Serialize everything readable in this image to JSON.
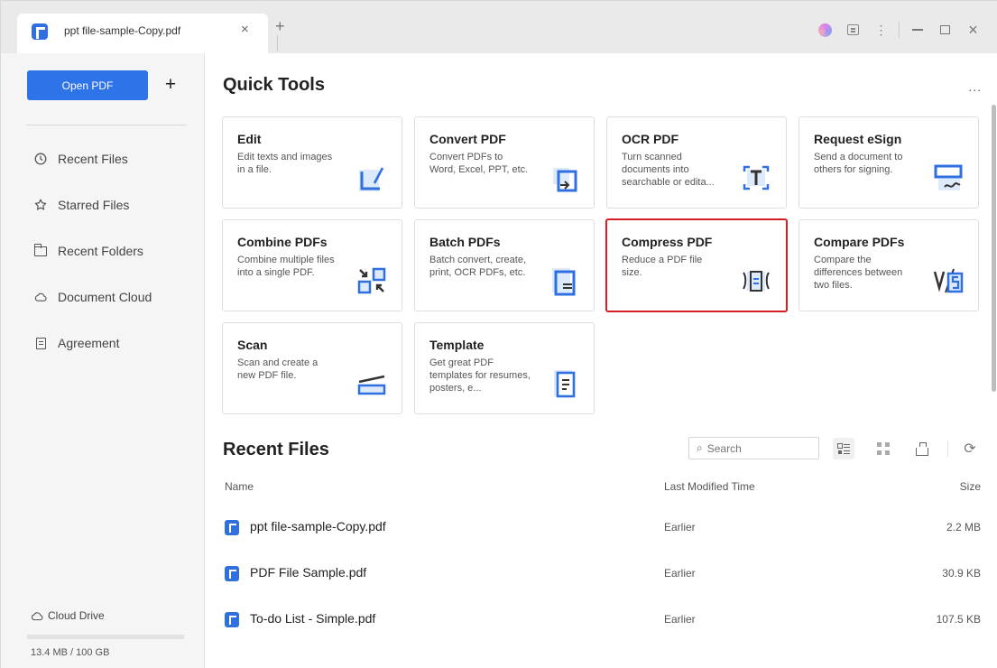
{
  "tab": {
    "title": "ppt file-sample-Copy.pdf",
    "close": "×",
    "new": "+"
  },
  "window_controls": {
    "close": "×"
  },
  "sidebar": {
    "open_label": "Open PDF",
    "plus_label": "+",
    "items": [
      {
        "label": "Recent Files",
        "icon": "clock-icon"
      },
      {
        "label": "Starred Files",
        "icon": "star-icon"
      },
      {
        "label": "Recent Folders",
        "icon": "folder-icon"
      },
      {
        "label": "Document Cloud",
        "icon": "cloud-icon"
      },
      {
        "label": "Agreement",
        "icon": "agreement-icon"
      }
    ],
    "cloud_drive_label": "Cloud Drive",
    "storage": {
      "text": "13.4 MB / 100 GB",
      "used_fraction": 0.000134
    }
  },
  "quick_tools": {
    "title": "Quick Tools",
    "more": "...",
    "cards": [
      {
        "title": "Edit",
        "desc": "Edit texts and images in a file.",
        "icon": "edit-icon"
      },
      {
        "title": "Convert PDF",
        "desc": "Convert PDFs to Word, Excel, PPT, etc.",
        "icon": "convert-icon"
      },
      {
        "title": "OCR PDF",
        "desc": "Turn scanned documents into searchable or edita...",
        "icon": "ocr-icon"
      },
      {
        "title": "Request eSign",
        "desc": "Send a document to others for signing.",
        "icon": "esign-icon"
      },
      {
        "title": "Combine PDFs",
        "desc": "Combine multiple files into a single PDF.",
        "icon": "combine-icon"
      },
      {
        "title": "Batch PDFs",
        "desc": "Batch convert, create, print, OCR PDFs, etc.",
        "icon": "batch-icon"
      },
      {
        "title": "Compress PDF",
        "desc": "Reduce a PDF file size.",
        "icon": "compress-icon"
      },
      {
        "title": "Compare PDFs",
        "desc": "Compare the differences between two files.",
        "icon": "compare-icon"
      },
      {
        "title": "Scan",
        "desc": "Scan and create a new PDF file.",
        "icon": "scan-icon"
      },
      {
        "title": "Template",
        "desc": "Get great PDF templates for resumes, posters, e...",
        "icon": "template-icon"
      }
    ]
  },
  "recent_files": {
    "title": "Recent Files",
    "search_placeholder": "Search",
    "columns": {
      "name": "Name",
      "modified": "Last Modified Time",
      "size": "Size"
    },
    "rows": [
      {
        "name": "ppt file-sample-Copy.pdf",
        "modified": "Earlier",
        "size": "2.2 MB"
      },
      {
        "name": "PDF File Sample.pdf",
        "modified": "Earlier",
        "size": "30.9 KB"
      },
      {
        "name": "To-do List - Simple.pdf",
        "modified": "Earlier",
        "size": "107.5 KB"
      }
    ]
  },
  "colors": {
    "accent": "#2f73e8",
    "selected_border": "#d51f26",
    "icon_blue": "#2f6fe0"
  }
}
